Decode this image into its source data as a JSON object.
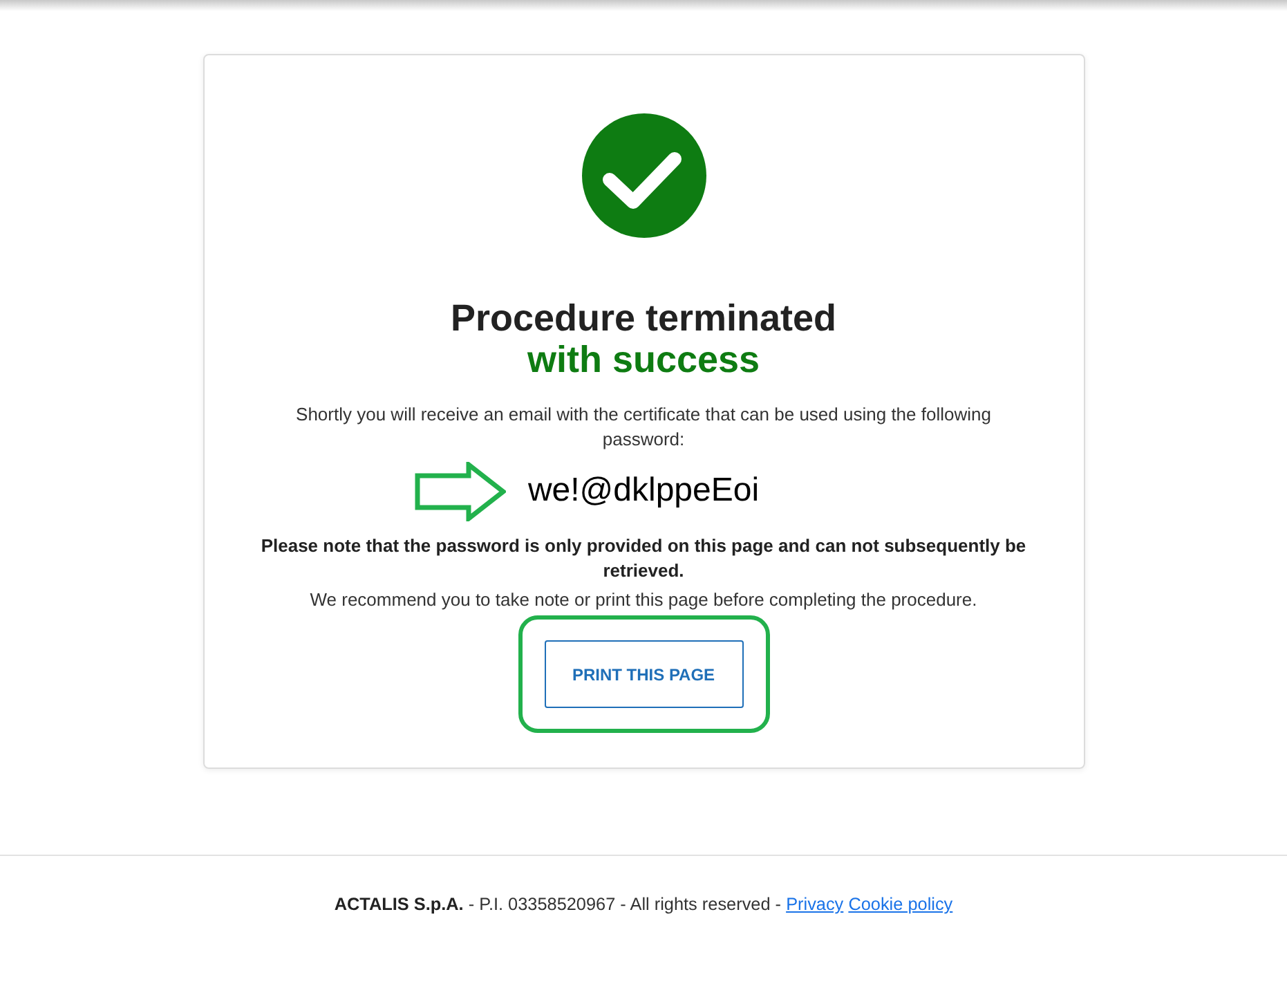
{
  "title": "Procedure terminated",
  "title_highlight": "with success",
  "message": "Shortly you will receive an email with the certificate that can be used using the following password:",
  "password": "we!@dklppeEoi",
  "note": "Please note that the password is only provided on this page and can not subsequently be retrieved.",
  "recommendation": "We recommend you to take note or print this page before completing the procedure.",
  "print_button": {
    "label": "PRINT THIS PAGE"
  },
  "footer": {
    "text": "**ACTALIS S.p.A.** - P.I. 03358520967 - All rights reserved -",
    "links": [
      "Privacy",
      "Cookie policy"
    ]
  }
}
